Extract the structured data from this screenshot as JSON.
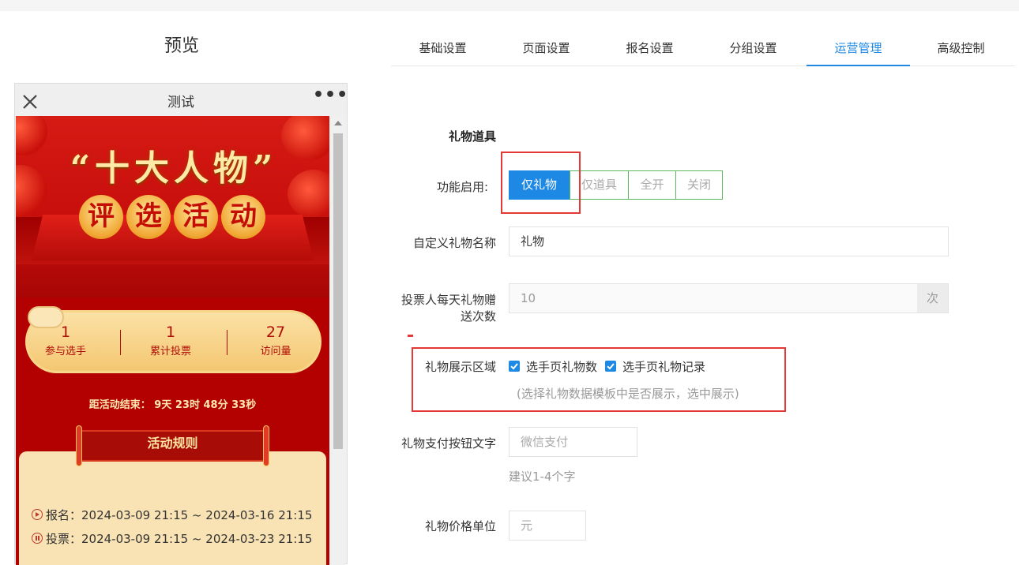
{
  "preview": {
    "title": "预览",
    "phone_title": "测试",
    "more_label": "•••",
    "banner": {
      "title_line1": "“十大人物”",
      "title_line2": [
        "评",
        "选",
        "活",
        "动"
      ]
    },
    "stats": [
      {
        "value": "1",
        "label": "参与选手"
      },
      {
        "value": "1",
        "label": "累计投票"
      },
      {
        "value": "27",
        "label": "访问量"
      }
    ],
    "countdown": "距活动结束：  9天 23时 48分 33秒",
    "rules_title": "活动规则",
    "rules": [
      "报名：2024-03-09 21:15 ~ 2024-03-16 21:15",
      "投票：2024-03-09 21:15 ~ 2024-03-23 21:15"
    ]
  },
  "tabs": [
    {
      "label": "基础设置"
    },
    {
      "label": "页面设置"
    },
    {
      "label": "报名设置"
    },
    {
      "label": "分组设置"
    },
    {
      "label": "运营管理",
      "active": true
    },
    {
      "label": "高级控制"
    }
  ],
  "form": {
    "section_title": "礼物道具",
    "feature_enable": {
      "label": "功能启用:",
      "options": [
        "仅礼物",
        "仅道具",
        "全开",
        "关闭"
      ],
      "selected": "仅礼物"
    },
    "custom_gift_name": {
      "label": "自定义礼物名称",
      "value": "礼物"
    },
    "daily_gift_count": {
      "label_line1": "投票人每天礼物赠",
      "label_line2": "送次数",
      "placeholder": "10",
      "unit": "次"
    },
    "display_area": {
      "label": "礼物展示区域",
      "options": [
        {
          "label": "选手页礼物数",
          "checked": true
        },
        {
          "label": "选手页礼物记录",
          "checked": true
        }
      ],
      "hint": "(选择礼物数据模板中是否展示，选中展示)"
    },
    "pay_button_text": {
      "label": "礼物支付按钮文字",
      "placeholder": "微信支付",
      "hint": "建议1-4个字"
    },
    "price_unit": {
      "label": "礼物价格单位",
      "placeholder": "元"
    }
  },
  "colors": {
    "accent": "#1e88e5",
    "highlight_box": "#e53935",
    "banner_red": "#b30000"
  }
}
